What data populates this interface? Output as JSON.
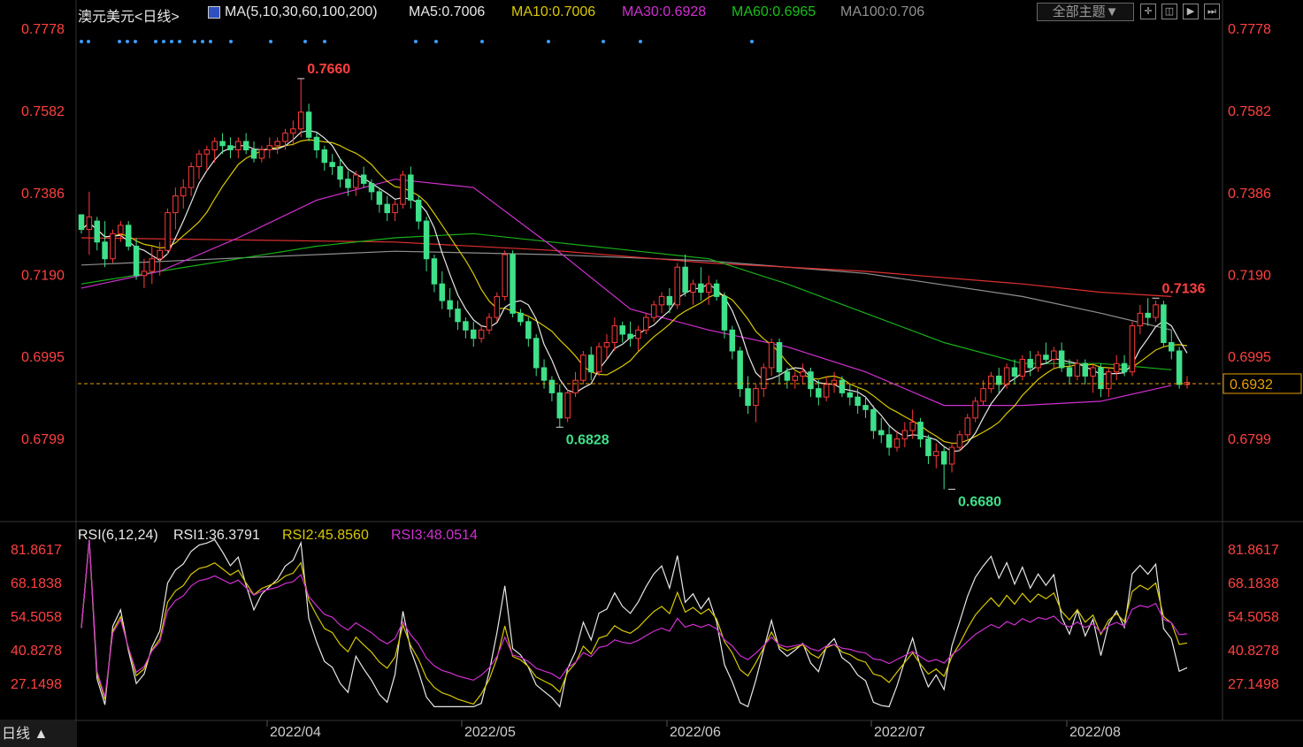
{
  "header": {
    "symbol": "澳元美元<日线>",
    "ma_label": "MA(5,10,30,60,100,200)",
    "ma5": "MA5:0.7006",
    "ma10": "MA10:0.7006",
    "ma30": "MA30:0.6928",
    "ma60": "MA60:0.6965",
    "ma100": "MA100:0.706",
    "theme_button": "全部主题▼"
  },
  "rsi_header": {
    "label": "RSI(6,12,24)",
    "rsi1": "RSI1:36.3791",
    "rsi2": "RSI2:45.8560",
    "rsi3": "RSI3:48.0514"
  },
  "bottom_tab": "日线 ▲",
  "colors": {
    "up": "#ff3a3a",
    "down": "#3ee08a",
    "ma5": "#e8e8e8",
    "ma10": "#d8c800",
    "ma30": "#d030d0",
    "ma60": "#18b018",
    "ma100": "#909090",
    "ma200": "#e03030",
    "axis_text": "#ff4040",
    "current_price": "#e8a000"
  },
  "chart_data": {
    "type": "candlestick",
    "price_axis": {
      "ticks": [
        "0.7778",
        "0.7582",
        "0.7386",
        "0.7190",
        "0.6995",
        "0.6799"
      ],
      "range": [
        0.6685,
        0.7785
      ]
    },
    "current_price": "0.6932",
    "annotations": {
      "high": "0.7660",
      "low_may": "0.6828",
      "low_jul": "0.6680",
      "high_aug": "0.7136"
    },
    "x_labels": [
      "2022/04",
      "2022/05",
      "2022/06",
      "2022/07",
      "2022/08"
    ],
    "candles": [
      [
        0.7335,
        0.7335,
        0.729,
        0.73
      ],
      [
        0.73,
        0.739,
        0.724,
        0.733
      ],
      [
        0.732,
        0.733,
        0.725,
        0.727
      ],
      [
        0.727,
        0.732,
        0.721,
        0.723
      ],
      [
        0.723,
        0.73,
        0.722,
        0.729
      ],
      [
        0.729,
        0.732,
        0.727,
        0.731
      ],
      [
        0.731,
        0.732,
        0.725,
        0.726
      ],
      [
        0.726,
        0.728,
        0.718,
        0.719
      ],
      [
        0.719,
        0.723,
        0.716,
        0.72
      ],
      [
        0.72,
        0.726,
        0.717,
        0.723
      ],
      [
        0.723,
        0.727,
        0.719,
        0.725
      ],
      [
        0.725,
        0.735,
        0.724,
        0.734
      ],
      [
        0.734,
        0.74,
        0.73,
        0.738
      ],
      [
        0.738,
        0.742,
        0.735,
        0.74
      ],
      [
        0.74,
        0.746,
        0.738,
        0.745
      ],
      [
        0.745,
        0.749,
        0.742,
        0.748
      ],
      [
        0.748,
        0.75,
        0.744,
        0.749
      ],
      [
        0.749,
        0.752,
        0.746,
        0.751
      ],
      [
        0.751,
        0.753,
        0.748,
        0.75
      ],
      [
        0.75,
        0.752,
        0.747,
        0.749
      ],
      [
        0.749,
        0.752,
        0.747,
        0.751
      ],
      [
        0.751,
        0.753,
        0.748,
        0.749
      ],
      [
        0.749,
        0.751,
        0.746,
        0.747
      ],
      [
        0.747,
        0.75,
        0.746,
        0.749
      ],
      [
        0.749,
        0.752,
        0.747,
        0.75
      ],
      [
        0.75,
        0.752,
        0.748,
        0.751
      ],
      [
        0.751,
        0.754,
        0.749,
        0.753
      ],
      [
        0.753,
        0.756,
        0.75,
        0.754
      ],
      [
        0.754,
        0.766,
        0.752,
        0.758
      ],
      [
        0.758,
        0.76,
        0.751,
        0.752
      ],
      [
        0.752,
        0.753,
        0.747,
        0.749
      ],
      [
        0.749,
        0.75,
        0.744,
        0.746
      ],
      [
        0.746,
        0.748,
        0.743,
        0.745
      ],
      [
        0.745,
        0.747,
        0.74,
        0.742
      ],
      [
        0.742,
        0.744,
        0.738,
        0.74
      ],
      [
        0.74,
        0.744,
        0.738,
        0.743
      ],
      [
        0.743,
        0.745,
        0.74,
        0.741
      ],
      [
        0.741,
        0.742,
        0.737,
        0.739
      ],
      [
        0.739,
        0.74,
        0.734,
        0.736
      ],
      [
        0.736,
        0.738,
        0.732,
        0.734
      ],
      [
        0.734,
        0.737,
        0.732,
        0.736
      ],
      [
        0.736,
        0.744,
        0.735,
        0.743
      ],
      [
        0.743,
        0.745,
        0.735,
        0.737
      ],
      [
        0.737,
        0.738,
        0.73,
        0.732
      ],
      [
        0.732,
        0.733,
        0.72,
        0.723
      ],
      [
        0.723,
        0.724,
        0.715,
        0.717
      ],
      [
        0.717,
        0.72,
        0.711,
        0.713
      ],
      [
        0.713,
        0.716,
        0.709,
        0.711
      ],
      [
        0.711,
        0.713,
        0.706,
        0.708
      ],
      [
        0.708,
        0.709,
        0.704,
        0.706
      ],
      [
        0.706,
        0.708,
        0.702,
        0.704
      ],
      [
        0.704,
        0.707,
        0.703,
        0.706
      ],
      [
        0.706,
        0.71,
        0.705,
        0.709
      ],
      [
        0.709,
        0.715,
        0.708,
        0.714
      ],
      [
        0.714,
        0.725,
        0.713,
        0.724
      ],
      [
        0.724,
        0.725,
        0.709,
        0.71
      ],
      [
        0.71,
        0.711,
        0.707,
        0.708
      ],
      [
        0.708,
        0.709,
        0.702,
        0.704
      ],
      [
        0.704,
        0.705,
        0.695,
        0.697
      ],
      [
        0.697,
        0.699,
        0.692,
        0.694
      ],
      [
        0.694,
        0.695,
        0.689,
        0.691
      ],
      [
        0.691,
        0.693,
        0.6828,
        0.685
      ],
      [
        0.685,
        0.692,
        0.684,
        0.691
      ],
      [
        0.691,
        0.696,
        0.69,
        0.694
      ],
      [
        0.694,
        0.701,
        0.693,
        0.7
      ],
      [
        0.7,
        0.702,
        0.694,
        0.696
      ],
      [
        0.696,
        0.703,
        0.695,
        0.702
      ],
      [
        0.702,
        0.705,
        0.699,
        0.703
      ],
      [
        0.703,
        0.709,
        0.701,
        0.707
      ],
      [
        0.707,
        0.708,
        0.703,
        0.705
      ],
      [
        0.705,
        0.708,
        0.702,
        0.704
      ],
      [
        0.704,
        0.707,
        0.701,
        0.706
      ],
      [
        0.706,
        0.71,
        0.705,
        0.709
      ],
      [
        0.709,
        0.713,
        0.708,
        0.712
      ],
      [
        0.712,
        0.715,
        0.71,
        0.714
      ],
      [
        0.714,
        0.716,
        0.71,
        0.712
      ],
      [
        0.712,
        0.722,
        0.711,
        0.721
      ],
      [
        0.721,
        0.724,
        0.714,
        0.715
      ],
      [
        0.715,
        0.718,
        0.712,
        0.717
      ],
      [
        0.717,
        0.721,
        0.713,
        0.715
      ],
      [
        0.715,
        0.719,
        0.712,
        0.717
      ],
      [
        0.717,
        0.718,
        0.713,
        0.714
      ],
      [
        0.714,
        0.715,
        0.704,
        0.706
      ],
      [
        0.706,
        0.707,
        0.699,
        0.701
      ],
      [
        0.701,
        0.702,
        0.69,
        0.692
      ],
      [
        0.692,
        0.695,
        0.686,
        0.688
      ],
      [
        0.688,
        0.693,
        0.684,
        0.692
      ],
      [
        0.692,
        0.698,
        0.69,
        0.697
      ],
      [
        0.697,
        0.704,
        0.695,
        0.703
      ],
      [
        0.703,
        0.704,
        0.693,
        0.696
      ],
      [
        0.696,
        0.697,
        0.692,
        0.694
      ],
      [
        0.694,
        0.696,
        0.692,
        0.695
      ],
      [
        0.695,
        0.698,
        0.693,
        0.696
      ],
      [
        0.696,
        0.697,
        0.69,
        0.692
      ],
      [
        0.692,
        0.694,
        0.688,
        0.69
      ],
      [
        0.69,
        0.695,
        0.689,
        0.693
      ],
      [
        0.693,
        0.696,
        0.691,
        0.694
      ],
      [
        0.694,
        0.695,
        0.69,
        0.691
      ],
      [
        0.691,
        0.693,
        0.688,
        0.69
      ],
      [
        0.69,
        0.692,
        0.686,
        0.688
      ],
      [
        0.688,
        0.69,
        0.685,
        0.687
      ],
      [
        0.687,
        0.688,
        0.68,
        0.682
      ],
      [
        0.682,
        0.685,
        0.679,
        0.681
      ],
      [
        0.681,
        0.683,
        0.676,
        0.678
      ],
      [
        0.678,
        0.682,
        0.677,
        0.68
      ],
      [
        0.68,
        0.684,
        0.678,
        0.682
      ],
      [
        0.682,
        0.687,
        0.68,
        0.684
      ],
      [
        0.684,
        0.685,
        0.678,
        0.68
      ],
      [
        0.68,
        0.681,
        0.674,
        0.676
      ],
      [
        0.676,
        0.679,
        0.673,
        0.677
      ],
      [
        0.677,
        0.678,
        0.668,
        0.674
      ],
      [
        0.674,
        0.679,
        0.672,
        0.678
      ],
      [
        0.678,
        0.682,
        0.677,
        0.681
      ],
      [
        0.681,
        0.686,
        0.68,
        0.685
      ],
      [
        0.685,
        0.69,
        0.684,
        0.689
      ],
      [
        0.689,
        0.694,
        0.688,
        0.692
      ],
      [
        0.692,
        0.696,
        0.691,
        0.695
      ],
      [
        0.695,
        0.697,
        0.691,
        0.693
      ],
      [
        0.693,
        0.698,
        0.692,
        0.697
      ],
      [
        0.697,
        0.699,
        0.693,
        0.695
      ],
      [
        0.695,
        0.7,
        0.694,
        0.699
      ],
      [
        0.699,
        0.701,
        0.695,
        0.697
      ],
      [
        0.697,
        0.701,
        0.696,
        0.7
      ],
      [
        0.7,
        0.703,
        0.698,
        0.699
      ],
      [
        0.699,
        0.702,
        0.697,
        0.701
      ],
      [
        0.701,
        0.703,
        0.696,
        0.697
      ],
      [
        0.697,
        0.699,
        0.693,
        0.695
      ],
      [
        0.695,
        0.699,
        0.694,
        0.698
      ],
      [
        0.698,
        0.699,
        0.693,
        0.695
      ],
      [
        0.695,
        0.698,
        0.691,
        0.697
      ],
      [
        0.697,
        0.698,
        0.69,
        0.692
      ],
      [
        0.692,
        0.697,
        0.69,
        0.696
      ],
      [
        0.696,
        0.7,
        0.694,
        0.698
      ],
      [
        0.698,
        0.7,
        0.695,
        0.696
      ],
      [
        0.696,
        0.708,
        0.695,
        0.707
      ],
      [
        0.707,
        0.712,
        0.705,
        0.71
      ],
      [
        0.71,
        0.7136,
        0.707,
        0.709
      ],
      [
        0.709,
        0.713,
        0.708,
        0.712
      ],
      [
        0.712,
        0.713,
        0.702,
        0.703
      ],
      [
        0.703,
        0.706,
        0.699,
        0.701
      ],
      [
        0.701,
        0.702,
        0.692,
        0.693
      ],
      [
        0.693,
        0.695,
        0.692,
        0.6935
      ]
    ],
    "ma_lines": [
      {
        "key": "ma100",
        "x": [
          0,
          20,
          40,
          60,
          80,
          100,
          120,
          130,
          139
        ],
        "y": [
          0.7215,
          0.7232,
          0.7248,
          0.724,
          0.7225,
          0.7195,
          0.714,
          0.71,
          0.706
        ]
      },
      {
        "key": "ma200",
        "x": [
          0,
          20,
          40,
          60,
          80,
          100,
          120,
          130,
          139
        ],
        "y": [
          0.728,
          0.7275,
          0.727,
          0.725,
          0.722,
          0.72,
          0.717,
          0.715,
          0.714
        ]
      },
      {
        "key": "ma60",
        "x": [
          0,
          10,
          20,
          30,
          40,
          50,
          60,
          70,
          80,
          90,
          100,
          110,
          120,
          130,
          139
        ],
        "y": [
          0.717,
          0.72,
          0.723,
          0.726,
          0.728,
          0.729,
          0.727,
          0.725,
          0.723,
          0.717,
          0.71,
          0.703,
          0.698,
          0.698,
          0.6965
        ]
      },
      {
        "key": "ma30",
        "x": [
          0,
          10,
          20,
          30,
          40,
          50,
          60,
          70,
          80,
          90,
          100,
          110,
          120,
          130,
          139
        ],
        "y": [
          0.716,
          0.72,
          0.728,
          0.737,
          0.742,
          0.74,
          0.726,
          0.711,
          0.706,
          0.702,
          0.696,
          0.688,
          0.688,
          0.689,
          0.6928
        ]
      }
    ],
    "rsi": {
      "ticks": [
        "81.8617",
        "68.1838",
        "54.5058",
        "40.8278",
        "27.1498"
      ],
      "range": [
        18,
        88
      ],
      "rsi1_last": 36.3791,
      "rsi2_last": 45.856,
      "rsi3_last": 48.0514
    }
  }
}
